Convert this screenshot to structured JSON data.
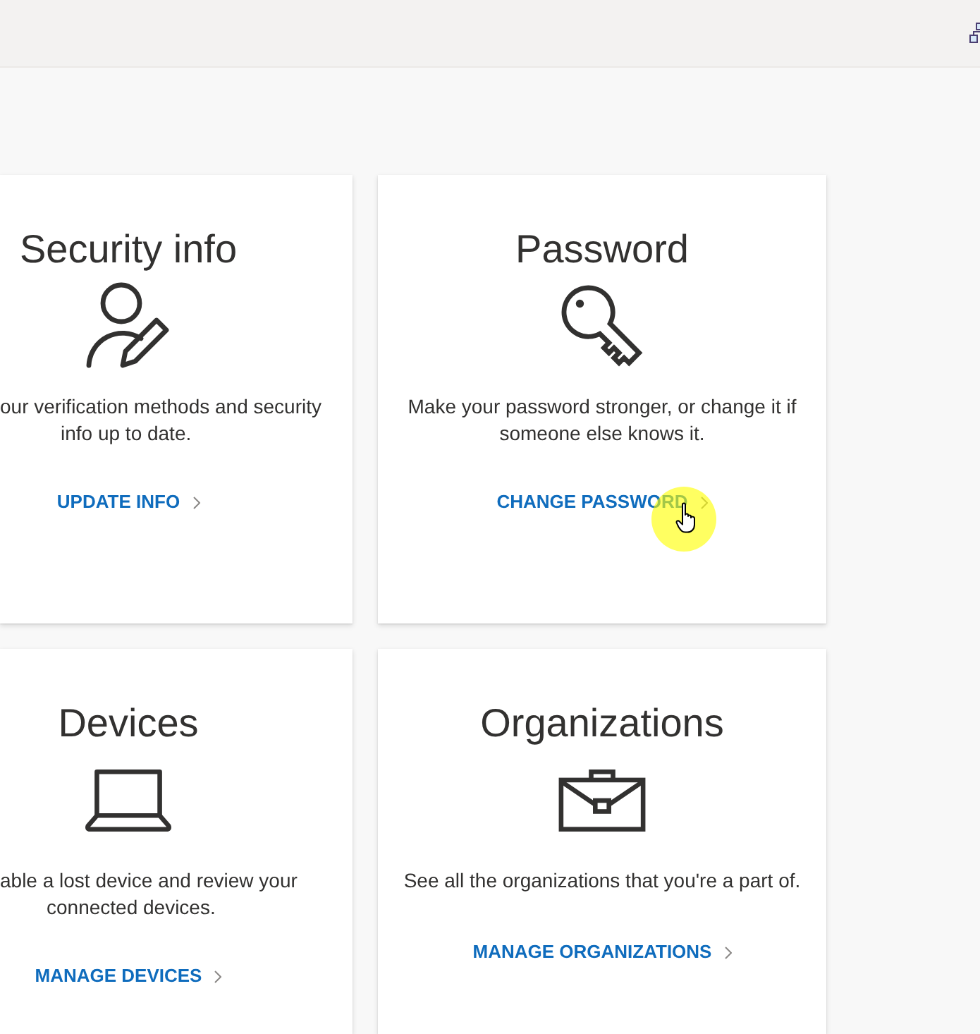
{
  "cards": [
    {
      "kind": "security",
      "title": "Security info",
      "description": "our verification methods and security info up to date.",
      "link": {
        "label": "UPDATE INFO",
        "hovered": false
      }
    },
    {
      "kind": "password",
      "title": "Password",
      "description": "Make your password stronger, or change it if someone else knows it.",
      "link": {
        "label": "CHANGE PASSWORD",
        "hovered": true
      }
    },
    {
      "kind": "devices",
      "title": "Devices",
      "description": "able a lost device and review your connected devices.",
      "link": {
        "label": "MANAGE DEVICES",
        "hovered": false
      }
    },
    {
      "kind": "organizations",
      "title": "Organizations",
      "description": "See all the organizations that you're a part of.",
      "link": {
        "label": "MANAGE ORGANIZATIONS",
        "hovered": false
      }
    }
  ]
}
